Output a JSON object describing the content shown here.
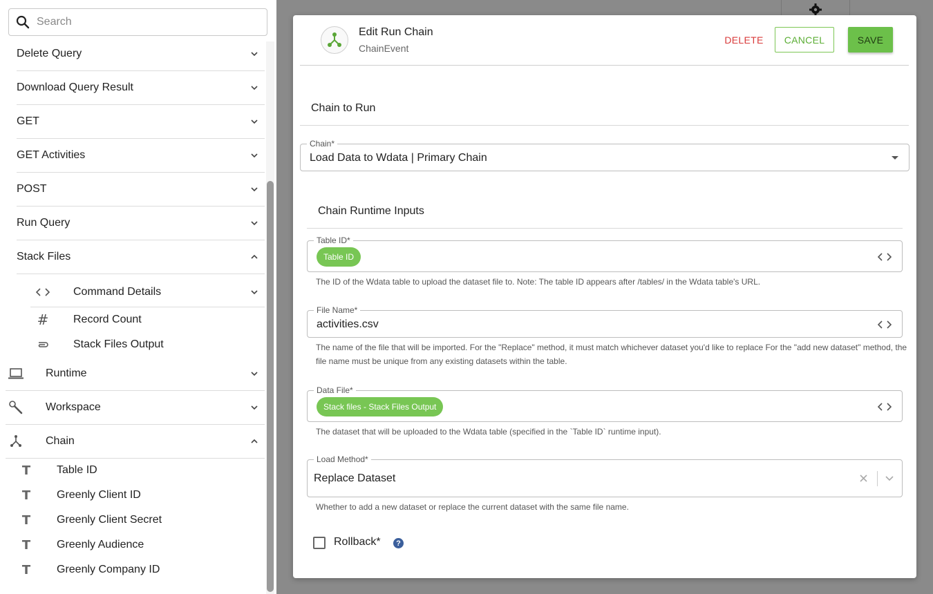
{
  "search": {
    "placeholder": "Search"
  },
  "sidebar": {
    "items": [
      {
        "label": "Delete Query"
      },
      {
        "label": "Download Query Result"
      },
      {
        "label": "GET"
      },
      {
        "label": "GET Activities"
      },
      {
        "label": "POST"
      },
      {
        "label": "Run Query"
      },
      {
        "label": "Stack Files"
      }
    ],
    "stack_files_children": [
      {
        "label": "Command Details",
        "icon": "code-icon"
      },
      {
        "label": "Record Count",
        "icon": "hash-icon"
      },
      {
        "label": "Stack Files Output",
        "icon": "paperclip-icon"
      }
    ],
    "sections": [
      {
        "label": "Runtime",
        "icon": "laptop-icon"
      },
      {
        "label": "Workspace",
        "icon": "wrench-icon"
      },
      {
        "label": "Chain",
        "icon": "chain-icon"
      }
    ],
    "chain_children": [
      {
        "label": "Table ID",
        "icon": "text-type-icon"
      },
      {
        "label": "Greenly Client ID",
        "icon": "text-type-icon"
      },
      {
        "label": "Greenly Client Secret",
        "icon": "text-type-icon"
      },
      {
        "label": "Greenly Audience",
        "icon": "text-type-icon"
      },
      {
        "label": "Greenly Company ID",
        "icon": "text-type-icon"
      }
    ]
  },
  "modal": {
    "title": "Edit Run Chain",
    "subtitle": "ChainEvent",
    "delete_label": "DELETE",
    "cancel_label": "CANCEL",
    "save_label": "SAVE",
    "chain_section_title": "Chain to Run",
    "chain_field": {
      "label": "Chain*",
      "value": "Load Data to Wdata | Primary Chain"
    },
    "runtime_section_title": "Chain Runtime Inputs",
    "table_id": {
      "label": "Table ID*",
      "chip": "Table ID",
      "help": "The ID of the Wdata table to upload the dataset file to. Note: The table ID appears after /tables/ in the Wdata table's URL."
    },
    "file_name": {
      "label": "File Name*",
      "value": "activities.csv",
      "help_line1": "The name of the file that will be imported. For the \"Replace\" method, it must match whichever dataset you'd like to replace For the \"add new dataset\" method, the",
      "help_line2": "file name must be unique from any existing datasets within the table."
    },
    "data_file": {
      "label": "Data File*",
      "chip": "Stack files - Stack Files Output",
      "help": "The dataset that will be uploaded to the Wdata table (specified in the `Table ID` runtime input)."
    },
    "load_method": {
      "label": "Load Method*",
      "value": "Replace Dataset",
      "help": "Whether to add a new dataset or replace the current dataset with the same file name."
    },
    "rollback": {
      "label": "Rollback*",
      "checked": false,
      "help_icon": "?"
    }
  },
  "colors": {
    "accent_green": "#6cc04a",
    "delete_red": "#d93a3a",
    "help_blue": "#3b5f9c"
  }
}
